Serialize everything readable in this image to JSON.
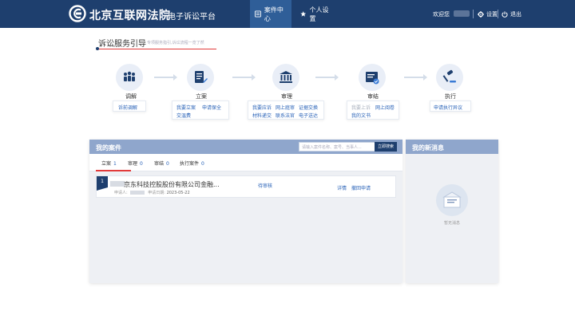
{
  "header": {
    "brand": "北京互联网法院",
    "platform": "电子诉讼平台",
    "nav": [
      {
        "label": "案件中心",
        "icon": "case-center-icon",
        "active": true
      },
      {
        "label": "个人设置",
        "icon": "star-icon",
        "active": false
      }
    ],
    "welcome": "欢迎您",
    "settings_label": "设置",
    "logout_label": "退出"
  },
  "guide": {
    "title": "诉讼服务引导",
    "subtitle": "专项服务指引,诉讼流程一览了然",
    "steps": [
      {
        "label": "调解",
        "links": [
          "诉前调解"
        ]
      },
      {
        "label": "立案",
        "links": [
          "我要立案",
          "申请保全",
          "交温费"
        ]
      },
      {
        "label": "审理",
        "links": [
          "我要应诉",
          "网上庭审",
          "证据交换",
          "材料递交",
          "联系法官",
          "电子送达"
        ]
      },
      {
        "label": "审结",
        "links": [
          "我要上诉",
          "网上阅卷",
          "我的文书"
        ]
      },
      {
        "label": "执行",
        "links": [
          "申请执行异议"
        ]
      }
    ]
  },
  "cases": {
    "title": "我的案件",
    "search_placeholder": "请输入案件名称、案号、当事人...",
    "search_button": "立即搜索",
    "tabs": [
      {
        "label": "立案",
        "count": "1"
      },
      {
        "label": "审理",
        "count": "0"
      },
      {
        "label": "审结",
        "count": "0"
      },
      {
        "label": "执行案件",
        "count": "0"
      }
    ],
    "items": [
      {
        "number": "1",
        "name": "京东科技控股股份有限公司金融...",
        "applicant_label": "申请人:",
        "date_label": "申请日期:",
        "date": "2023-05-22",
        "status": "待审核",
        "actions": [
          "详情",
          "撤回申请"
        ]
      }
    ]
  },
  "messages": {
    "title": "我的新消息",
    "empty_text": "暂无消息"
  },
  "colors": {
    "header_bg": "#1e3f6e",
    "panel_head": "#8fa6cc",
    "accent_red": "#e23a3a",
    "link_blue": "#2a63b8"
  }
}
